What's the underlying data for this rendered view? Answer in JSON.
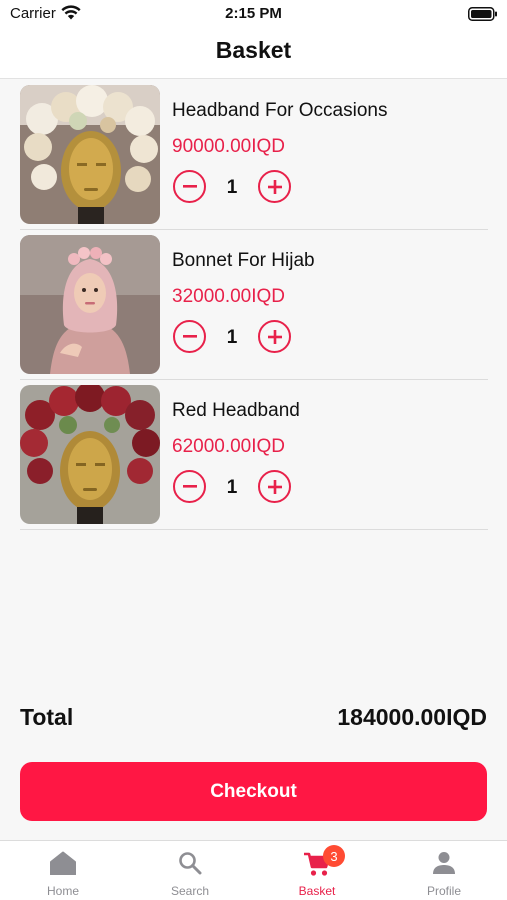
{
  "status_bar": {
    "carrier": "Carrier",
    "time": "2:15 PM"
  },
  "header": {
    "title": "Basket"
  },
  "items": [
    {
      "name": "Headband For Occasions",
      "price": "90000.00IQD",
      "quantity": "1"
    },
    {
      "name": "Bonnet For Hijab",
      "price": "32000.00IQD",
      "quantity": "1"
    },
    {
      "name": "Red Headband",
      "price": "62000.00IQD",
      "quantity": "1"
    }
  ],
  "summary": {
    "total_label": "Total",
    "total_value": "184000.00IQD"
  },
  "checkout": {
    "label": "Checkout"
  },
  "tabs": [
    {
      "label": "Home",
      "icon": "home-icon"
    },
    {
      "label": "Search",
      "icon": "search-icon"
    },
    {
      "label": "Basket",
      "icon": "cart-icon",
      "badge": "3",
      "active": true
    },
    {
      "label": "Profile",
      "icon": "person-icon"
    }
  ],
  "colors": {
    "accent": "#ff1744",
    "price": "#e8214a",
    "badge": "#ff4b33"
  }
}
